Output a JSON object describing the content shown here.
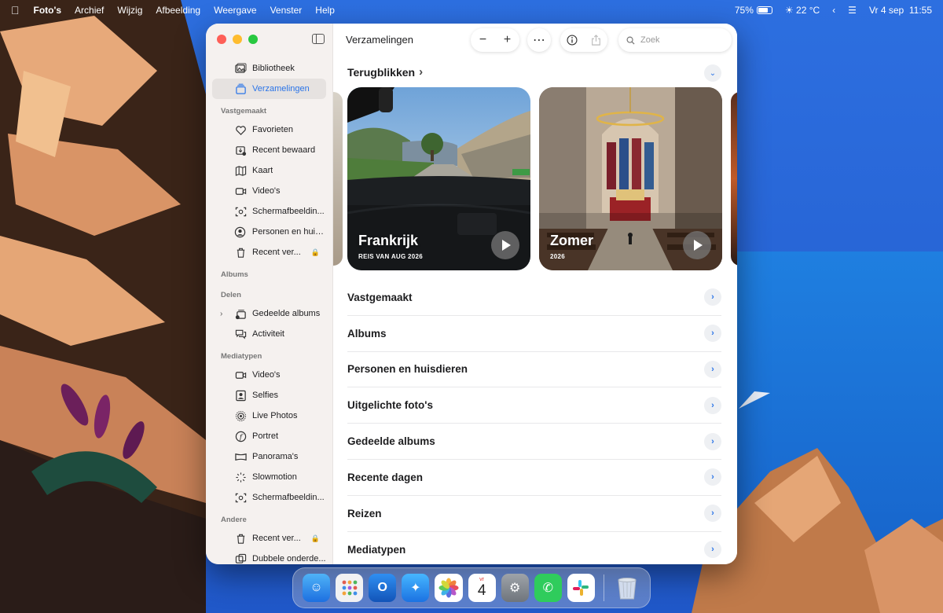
{
  "menubar": {
    "app": "Foto's",
    "menus": [
      "Archief",
      "Wijzig",
      "Afbeelding",
      "Weergave",
      "Venster",
      "Help"
    ],
    "battery": "75%",
    "battery_level": 0.75,
    "weather": "22 °C",
    "date": "Vr 4 sep",
    "time": "11:55"
  },
  "sidebar": {
    "top": [
      {
        "label": "Bibliotheek",
        "icon": "photo-library-icon"
      },
      {
        "label": "Verzamelingen",
        "icon": "collections-icon"
      }
    ],
    "pinned_header": "Vastgemaakt",
    "pinned": [
      {
        "label": "Favorieten",
        "icon": "heart-icon"
      },
      {
        "label": "Recent bewaard",
        "icon": "recently-saved-icon"
      },
      {
        "label": "Kaart",
        "icon": "map-icon"
      },
      {
        "label": "Video's",
        "icon": "video-icon"
      },
      {
        "label": "Schermafbeeldin...",
        "icon": "screenshot-icon"
      },
      {
        "label": "Personen en huis...",
        "icon": "person-icon"
      },
      {
        "label": "Recent ver...",
        "icon": "trash-icon"
      }
    ],
    "albums_header": "Albums",
    "sharing_header": "Delen",
    "sharing": [
      {
        "label": "Gedeelde albums",
        "icon": "shared-albums-icon"
      },
      {
        "label": "Activiteit",
        "icon": "activity-icon"
      }
    ],
    "media_header": "Mediatypen",
    "media": [
      {
        "label": "Video's",
        "icon": "video-icon"
      },
      {
        "label": "Selfies",
        "icon": "selfie-icon"
      },
      {
        "label": "Live Photos",
        "icon": "live-photo-icon"
      },
      {
        "label": "Portret",
        "icon": "portrait-icon"
      },
      {
        "label": "Panorama's",
        "icon": "panorama-icon"
      },
      {
        "label": "Slowmotion",
        "icon": "slowmotion-icon"
      },
      {
        "label": "Schermafbeeldin...",
        "icon": "screenshot-icon"
      }
    ],
    "other_header": "Andere",
    "other": [
      {
        "label": "Recent ver...",
        "icon": "trash-icon"
      },
      {
        "label": "Dubbele onderde...",
        "icon": "duplicates-icon"
      }
    ]
  },
  "toolbar": {
    "title": "Verzamelingen",
    "search_placeholder": "Zoek"
  },
  "memories": {
    "header": "Terugblikken",
    "cards": [
      {
        "title": "Frankrijk",
        "subtitle": "REIS VAN AUG 2026"
      },
      {
        "title": "Zomer",
        "subtitle": "2026"
      }
    ]
  },
  "collections": [
    "Vastgemaakt",
    "Albums",
    "Personen en huisdieren",
    "Uitgelichte foto's",
    "Gedeelde albums",
    "Recente dagen",
    "Reizen",
    "Mediatypen"
  ],
  "dock": {
    "calendar_day": "4",
    "calendar_weekday": "vr",
    "apps": [
      "finder-icon",
      "launchpad-icon",
      "outlook-icon",
      "safari-icon",
      "photos-icon",
      "calendar-icon",
      "system-settings-icon",
      "whatsapp-icon",
      "slack-icon",
      "trash-icon"
    ]
  }
}
